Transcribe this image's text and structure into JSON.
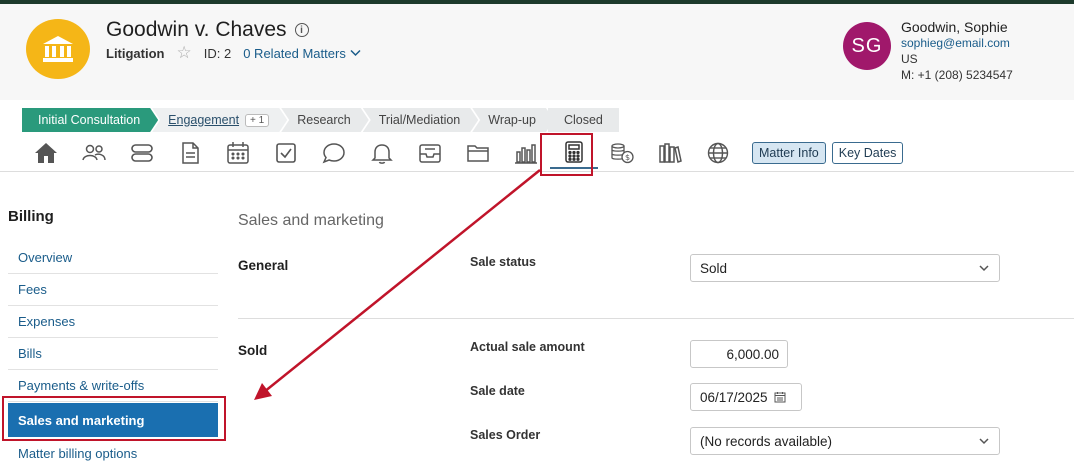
{
  "matter": {
    "title": "Goodwin v. Chaves",
    "type": "Litigation",
    "id_label": "ID: 2",
    "related_label": "0 Related Matters"
  },
  "contact": {
    "initials": "SG",
    "name": "Goodwin, Sophie",
    "email": "sophieg@email.com",
    "country": "US",
    "phone": "M: +1 (208) 5234547"
  },
  "stages": [
    {
      "label": "Initial Consultation"
    },
    {
      "label": "Engagement",
      "badge": "+ 1"
    },
    {
      "label": "Research"
    },
    {
      "label": "Trial/Mediation"
    },
    {
      "label": "Wrap-up"
    },
    {
      "label": "Closed"
    }
  ],
  "toolbar": {
    "icons": [
      "home-icon",
      "people-icon",
      "stack-icon",
      "document-icon",
      "calendar-icon",
      "checkbox-icon",
      "chat-icon",
      "bell-icon",
      "inbox-icon",
      "folder-icon",
      "bar-chart-icon",
      "calculator-icon",
      "coins-icon",
      "books-icon",
      "globe-icon"
    ],
    "matter_info": "Matter Info",
    "key_dates": "Key Dates"
  },
  "sidebar": {
    "title": "Billing",
    "items": [
      {
        "label": "Overview"
      },
      {
        "label": "Fees"
      },
      {
        "label": "Expenses"
      },
      {
        "label": "Bills"
      },
      {
        "label": "Payments & write-offs"
      },
      {
        "label": "Sales and marketing"
      },
      {
        "label": "Matter billing options"
      }
    ]
  },
  "main": {
    "title": "Sales and marketing",
    "general": {
      "section": "General",
      "sale_status_label": "Sale status",
      "sale_status_value": "Sold"
    },
    "sold": {
      "section": "Sold",
      "amount_label": "Actual sale amount",
      "amount_value": "6,000.00",
      "date_label": "Sale date",
      "date_value": "06/17/2025",
      "order_label": "Sales Order",
      "order_value": "(No records available)"
    }
  },
  "colors": {
    "accent": "#1a6fb0",
    "highlight": "#c0142a",
    "stage_active": "#2a9a7c",
    "avatar": "#a0186b",
    "logo": "#f5b617"
  }
}
